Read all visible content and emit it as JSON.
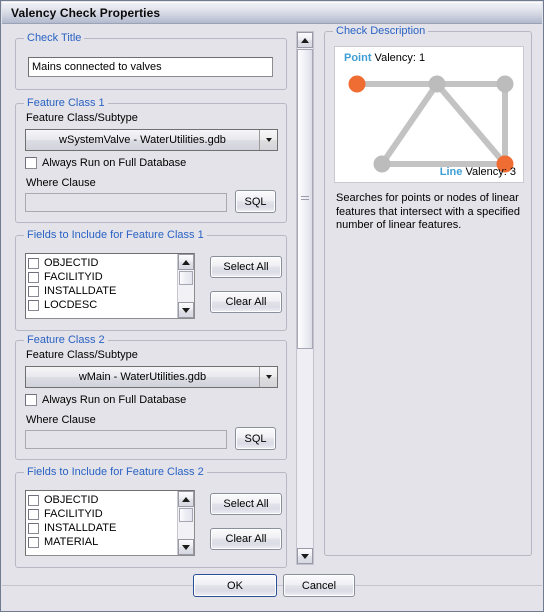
{
  "window": {
    "title": "Valency Check Properties"
  },
  "check_title": {
    "legend": "Check Title",
    "value": "Mains connected to valves",
    "placeholder": ""
  },
  "feature_class_1": {
    "legend": "Feature Class 1",
    "subtype_label": "Feature Class/Subtype",
    "subtype_value": "wSystemValve -  WaterUtilities.gdb",
    "always_run_label": "Always Run on Full Database",
    "always_run_checked": false,
    "where_label": "Where Clause",
    "where_value": "",
    "sql_label": "SQL"
  },
  "fields_1": {
    "legend": "Fields to Include for Feature Class 1",
    "items": [
      {
        "label": "OBJECTID",
        "checked": false
      },
      {
        "label": "FACILITYID",
        "checked": false
      },
      {
        "label": "INSTALLDATE",
        "checked": false
      },
      {
        "label": "LOCDESC",
        "checked": false
      }
    ],
    "select_all_label": "Select All",
    "clear_all_label": "Clear All"
  },
  "feature_class_2": {
    "legend": "Feature Class 2",
    "subtype_label": "Feature Class/Subtype",
    "subtype_value": "wMain -  WaterUtilities.gdb",
    "always_run_label": "Always Run on Full Database",
    "always_run_checked": false,
    "where_label": "Where Clause",
    "where_value": "",
    "sql_label": "SQL"
  },
  "fields_2": {
    "legend": "Fields to Include for Feature Class 2",
    "items": [
      {
        "label": "OBJECTID",
        "checked": false
      },
      {
        "label": "FACILITYID",
        "checked": false
      },
      {
        "label": "INSTALLDATE",
        "checked": false
      },
      {
        "label": "MATERIAL",
        "checked": false
      }
    ],
    "select_all_label": "Select All",
    "clear_all_label": "Clear All"
  },
  "check_description": {
    "legend": "Check Description",
    "point_label": "Point",
    "point_value": " Valency: 1",
    "line_label": "Line",
    "line_value": " Valency: 3",
    "text": "Searches for points or nodes of linear features that intersect with a specified number of linear features.",
    "accent_color": "#3f9fd4",
    "highlight_color": "#ef6c32",
    "node_color": "#bcbcbc"
  },
  "footer": {
    "ok_label": "OK",
    "cancel_label": "Cancel"
  },
  "scrollbar": {
    "up_icon": "chevron-up-icon",
    "down_icon": "chevron-down-icon"
  }
}
